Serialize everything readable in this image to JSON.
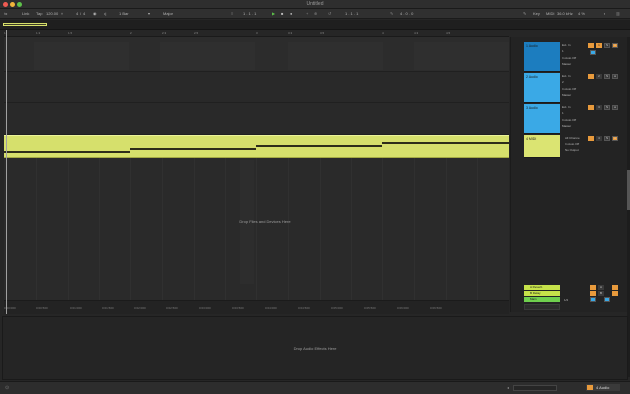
{
  "window": {
    "title": "Untitled"
  },
  "control_bar": {
    "link": "Link",
    "tap": "Tap",
    "tempo": "120.00",
    "meter_num": "4",
    "meter_den": "4",
    "metronome_icon": "metronome-icon",
    "quantize": "1 Bar",
    "key": "Major",
    "position": "1 . 1 . 1",
    "loop_start": "1 . 1 . 1",
    "loop_len": "4 . 0 . 0",
    "key_label": "Key",
    "midi_label": "MIDI",
    "cpu": "36.0 kHz",
    "cpu_pct": "4 %"
  },
  "ruler": {
    "ticks": [
      "1",
      "1.3",
      "1.5",
      "2",
      "2.3",
      "2.5",
      "3",
      "3.3",
      "3.5",
      "4",
      "4.3",
      "4.5"
    ]
  },
  "timeline": {
    "ticks": [
      "0:00:000",
      "0:00:500",
      "0:01:000",
      "0:01:500",
      "0:02:000",
      "0:02:500",
      "0:03:000",
      "0:03:500",
      "0:04:000",
      "0:04:500",
      "0:05:000",
      "0:05:500",
      "0:06:000",
      "0:06:500"
    ]
  },
  "arrangement": {
    "drop_hint": "Drop Files and Devices Here"
  },
  "tracks": [
    {
      "name": "1 Audio",
      "color": "#1c7dbf",
      "input": "Ext. In",
      "channel": "1",
      "monitor": "In Auto Off",
      "output": "Master",
      "number": "1"
    },
    {
      "name": "2 Audio",
      "color": "#3aa9e6",
      "input": "Ext. In",
      "channel": "2",
      "monitor": "In Auto Off",
      "output": "Master",
      "number": "2"
    },
    {
      "name": "3 Audio",
      "color": "#3aa9e6",
      "input": "Ext. In",
      "channel": "1",
      "monitor": "In Auto Off",
      "output": "Master",
      "number": "3"
    },
    {
      "name": "4 MIDI",
      "color": "#dbe472",
      "input": "All Channe",
      "channel": "",
      "monitor": "In Auto Off",
      "output": "No Output",
      "number": "4"
    }
  ],
  "returns": [
    {
      "name": "A Reverb",
      "letter": "A"
    },
    {
      "name": "B Delay",
      "letter": "B"
    },
    {
      "name": "Main",
      "letter": ""
    }
  ],
  "main_value": "1/2",
  "detail": {
    "drop_hint": "Drop Audio Effects Here"
  },
  "status": {
    "selected_track": "4 Audio"
  }
}
